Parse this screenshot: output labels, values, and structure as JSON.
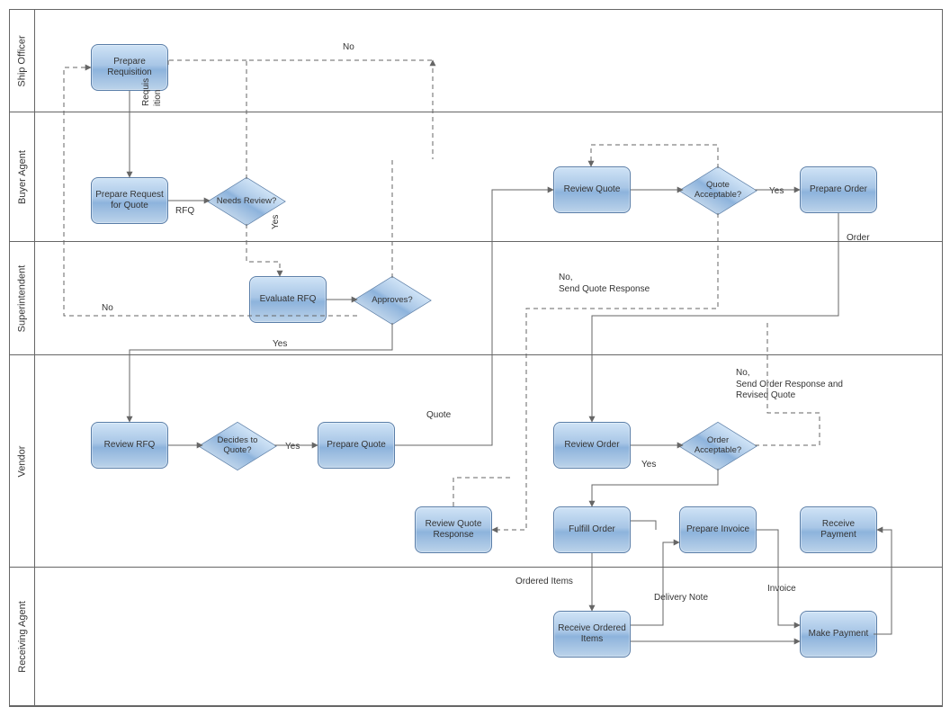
{
  "lanes": {
    "ship_officer": "Ship Officer",
    "buyer_agent": "Buyer Agent",
    "superintendent": "Superintendent",
    "vendor": "Vendor",
    "receiving_agent": "Receiving Agent"
  },
  "nodes": {
    "prepare_requisition": "Prepare Requisition",
    "prepare_rfq": "Prepare Request for Quote",
    "needs_review": "Needs Review?",
    "evaluate_rfq": "Evaluate RFQ",
    "approves": "Approves?",
    "review_rfq": "Review RFQ",
    "decides_to_quote": "Decides to Quote?",
    "prepare_quote": "Prepare Quote",
    "review_quote": "Review Quote",
    "quote_acceptable": "Quote Acceptable?",
    "prepare_order": "Prepare Order",
    "review_quote_response": "Review Quote Response",
    "review_order": "Review Order",
    "order_acceptable": "Order Acceptable?",
    "fulfill_order": "Fulfill Order",
    "prepare_invoice": "Prepare Invoice",
    "receive_payment": "Receive Payment",
    "receive_ordered_items": "Receive Ordered Items",
    "make_payment": "Make Payment"
  },
  "edge_labels": {
    "requisition": "Requis\nition",
    "rfq": "RFQ",
    "yes1": "Yes",
    "no_top": "No",
    "no_left": "No",
    "yes_super": "Yes",
    "yes_decides": "Yes",
    "quote": "Quote",
    "yes_quote_acc": "Yes",
    "no_send_quote_resp": "No,\nSend Quote Response",
    "order": "Order",
    "no_send_order_resp": "No,\nSend Order Response and\nRevised Quote",
    "yes_order_acc": "Yes",
    "ordered_items": "Ordered Items",
    "delivery_note": "Delivery Note",
    "invoice": "Invoice"
  }
}
